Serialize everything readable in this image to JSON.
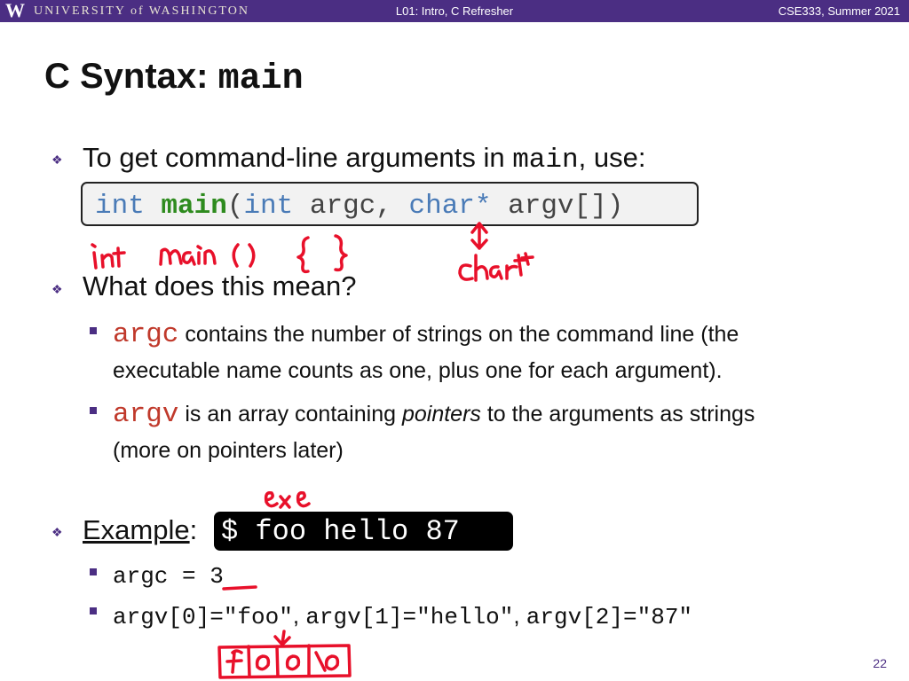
{
  "header": {
    "logo": "W",
    "university": "UNIVERSITY of WASHINGTON",
    "lecture": "L01: Intro, C Refresher",
    "course": "CSE333, Summer 2021"
  },
  "title": {
    "text": "C Syntax: ",
    "code": "main"
  },
  "bullets": {
    "b1": {
      "pre": "To get command-line arguments in ",
      "code": "main",
      "post": ", use:"
    },
    "signature": {
      "kw1": "int",
      "fn": "main",
      "p1": "(",
      "kw2": "int",
      "p2": " argc, ",
      "kw3": "char*",
      "p3": " argv[])"
    },
    "b2": "What does this mean?",
    "argc": {
      "code": "argc",
      "line1": " contains the number of strings on the command line (the",
      "line2": "executable name counts as one, plus one for each argument)."
    },
    "argv": {
      "code": "argv",
      "pre": " is an array containing ",
      "em": "pointers",
      "post": " to the arguments as strings",
      "line2": "(more on pointers later)"
    },
    "example": {
      "label": "Example",
      "colon": ":",
      "command": "$ foo hello 87"
    },
    "argc_value": "argc = 3",
    "argv_values": {
      "a0": "argv[0]=\"foo\"",
      "sep1": ", ",
      "a1": "argv[1]=\"hello\"",
      "sep2": ", ",
      "a2": "argv[2]=\"87\""
    }
  },
  "page_number": "22",
  "colors": {
    "header_purple": "#4b2e83",
    "ink_red": "#e8102a",
    "keyword_blue": "#4a7bb7",
    "function_green": "#2e8b1e"
  }
}
